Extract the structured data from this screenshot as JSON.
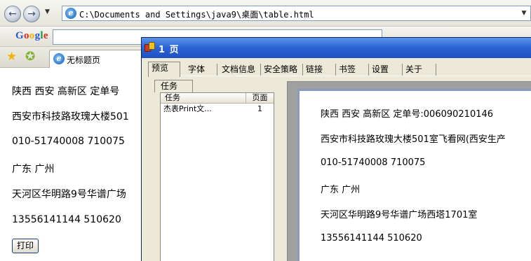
{
  "browser": {
    "address": "C:\\Documents and Settings\\java9\\桌面\\table.html",
    "google_logo": "Google",
    "tab_title": "无标题页"
  },
  "page": {
    "lines": [
      "陕西 西安 高新区 定单号",
      "西安市科技路玫瑰大楼501",
      "010-51740008 710075",
      "广东 广州",
      "天河区华明路9号华谱广场",
      "13556141144 510620"
    ],
    "print_button": "打印"
  },
  "preview": {
    "title": "1 页",
    "tabs": [
      "预览",
      "字体",
      "文档信息",
      "安全策略",
      "链接",
      "书签",
      "设置",
      "关于"
    ],
    "active_tab": "预览",
    "task_tab": "任务",
    "columns": {
      "task": "任务",
      "page": "页面"
    },
    "rows": [
      {
        "name": "杰表Print文...",
        "page": "1"
      }
    ],
    "content": [
      "陕西 西安 高新区 定单号:006090210146",
      "西安市科技路玫瑰大楼501室飞看网(西安生产",
      "010-51740008 710075",
      "广东 广州",
      "天河区华明路9号华谱广场西塔1701室",
      "13556141144 510620"
    ]
  }
}
